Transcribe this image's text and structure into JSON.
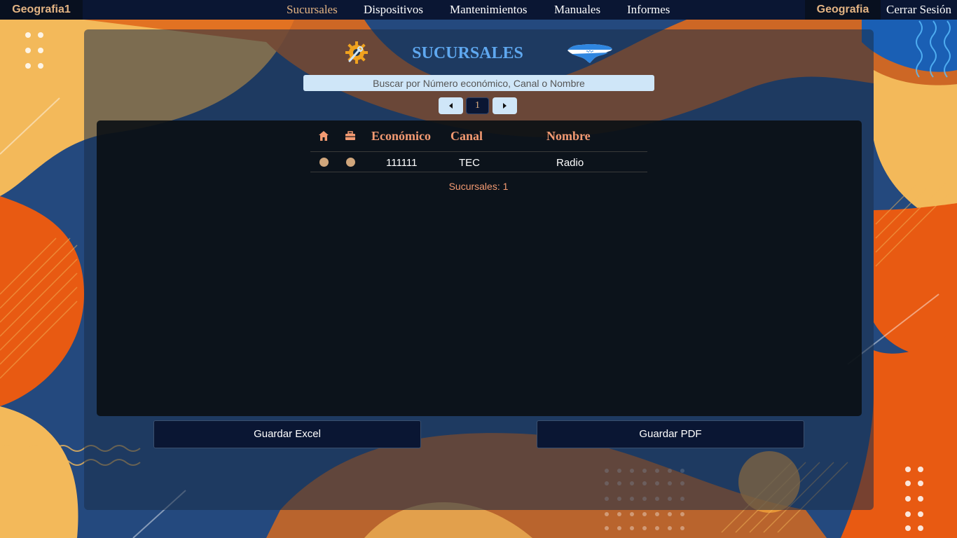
{
  "header": {
    "brand": "Geografia1",
    "nav": [
      {
        "label": "Sucursales",
        "active": true
      },
      {
        "label": "Dispositivos",
        "active": false
      },
      {
        "label": "Mantenimientos",
        "active": false
      },
      {
        "label": "Manuales",
        "active": false
      },
      {
        "label": "Informes",
        "active": false
      }
    ],
    "user": "Geografia",
    "logout": "Cerrar Sesión"
  },
  "page": {
    "title": "SUCURSALES",
    "search_placeholder": "Buscar por Número económico, Canal o Nombre",
    "pagination": {
      "current": "1"
    }
  },
  "table": {
    "columns": [
      "Económico",
      "Canal",
      "Nombre"
    ],
    "header_icons": [
      "home-icon",
      "toolbox-icon"
    ],
    "rows": [
      {
        "economico": "111111",
        "canal": "TEC",
        "nombre": "Radio"
      }
    ],
    "count_label": "Sucursales: 1"
  },
  "actions": {
    "excel": "Guardar Excel",
    "pdf": "Guardar PDF"
  },
  "colors": {
    "accent": "#e3b483",
    "header_text": "#f39a72",
    "title": "#5fa8f0",
    "navbar": "#0a1633"
  }
}
